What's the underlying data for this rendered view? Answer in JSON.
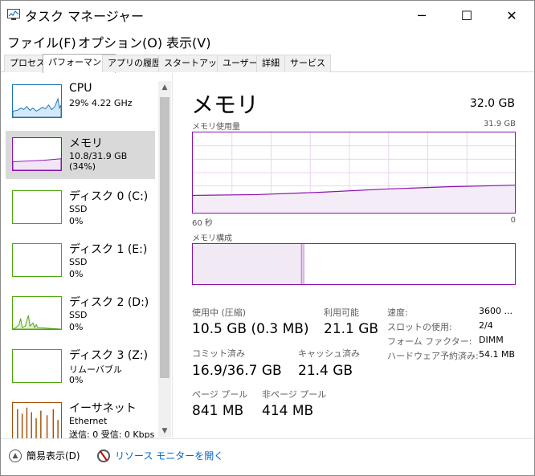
{
  "window": {
    "title": "タスク マネージャー",
    "minimize": "─",
    "maximize": "☐",
    "close": "✕"
  },
  "menu": [
    "ファイル(F)",
    "オプション(O)",
    "表示(V)"
  ],
  "tabs": [
    "プロセス",
    "パフォーマンス",
    "アプリの履歴",
    "スタートアップ",
    "ユーザー",
    "詳細",
    "サービス"
  ],
  "active_tab": "パフォーマンス",
  "sidebar": {
    "items": [
      {
        "name": "CPU",
        "sub1": "29%  4.22 GHz",
        "sub2": ""
      },
      {
        "name": "メモリ",
        "sub1": "10.8/31.9 GB (34%)",
        "sub2": ""
      },
      {
        "name": "ディスク 0 (C:)",
        "sub1": "SSD",
        "sub2": "0%"
      },
      {
        "name": "ディスク 1 (E:)",
        "sub1": "SSD",
        "sub2": "0%"
      },
      {
        "name": "ディスク 2 (D:)",
        "sub1": "SSD",
        "sub2": "0%"
      },
      {
        "name": "ディスク 3 (Z:)",
        "sub1": "リムーバブル",
        "sub2": "0%"
      },
      {
        "name": "イーサネット",
        "sub1": "Ethernet",
        "sub2": "送信: 0 受信: 0 Kbps"
      }
    ],
    "colors": {
      "cpu": "#1a73b8",
      "memory": "#8b12ae",
      "disk": "#4da60c",
      "ethernet": "#a74f01"
    }
  },
  "main": {
    "title": "メモリ",
    "total": "32.0 GB",
    "usage_label": "メモリ使用量",
    "usage_max": "31.9 GB",
    "time_left": "60 秒",
    "time_right": "0",
    "composition_label": "メモリ構成",
    "stats": {
      "in_use_label": "使用中 (圧縮)",
      "in_use_value": "10.5 GB (0.3 MB)",
      "available_label": "利用可能",
      "available_value": "21.1 GB",
      "committed_label": "コミット済み",
      "committed_value": "16.9/36.7 GB",
      "cached_label": "キャッシュ済み",
      "cached_value": "21.4 GB",
      "paged_label": "ページ プール",
      "paged_value": "841 MB",
      "nonpaged_label": "非ページ プール",
      "nonpaged_value": "414 MB"
    },
    "details": [
      {
        "label": "速度:",
        "value": "3600 ..."
      },
      {
        "label": "スロットの使用:",
        "value": "2/4"
      },
      {
        "label": "フォーム ファクター:",
        "value": "DIMM"
      },
      {
        "label": "ハードウェア予約済み:",
        "value": "54.1 MB"
      }
    ]
  },
  "footer": {
    "fewer_details": "簡易表示(D)",
    "resource_monitor": "リソース モニターを開く"
  }
}
